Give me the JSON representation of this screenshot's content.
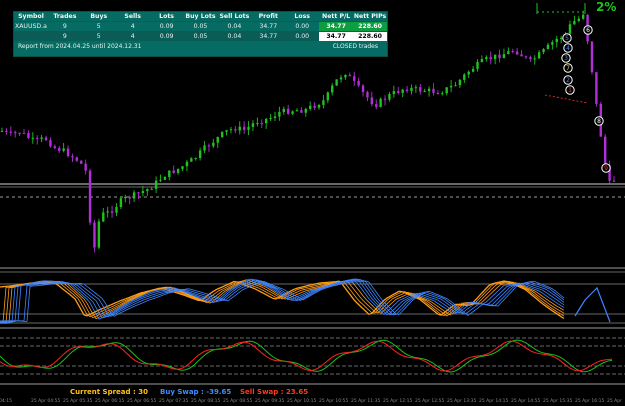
{
  "colors": {
    "bg": "#000000",
    "bull": "#1fc21f",
    "bear": "#b12fd8",
    "panel_bg": "#066b63",
    "swap_buy": "#3d8eff",
    "swap_sell": "#ff3b1f",
    "spread": "#ffc21a",
    "osc_orange": "#ff9c16",
    "osc_blue": "#3f86ff",
    "sig_green": "#18c218",
    "sig_red": "#ff2020"
  },
  "percent_badge": "2%",
  "trades_table": {
    "headers": [
      "Symbol",
      "Trades",
      "Buys",
      "Sells",
      "Lots",
      "Buy Lots",
      "Sell Lots",
      "Profit",
      "Loss",
      "Nett P/L",
      "Nett PIPs"
    ],
    "rows": [
      [
        "XAUUSD.a",
        "9",
        "5",
        "4",
        "0.09",
        "0.05",
        "0.04",
        "34.77",
        "0.00",
        "34.77",
        "228.60"
      ],
      [
        "",
        "9",
        "5",
        "4",
        "0.09",
        "0.05",
        "0.04",
        "34.77",
        "0.00",
        "34.77",
        "228.60"
      ]
    ]
  },
  "report": {
    "left": "Report from 2024.04.25 until 2024.12.31",
    "right": "CLOSED trades"
  },
  "status_bar": {
    "spread": "Current Spread : 30",
    "buy_swap": "Buy Swap : -39.65",
    "sell_swap": "Sell Swap : 23.65"
  },
  "trade_markers": [
    "4",
    "5",
    "6",
    "3",
    "7",
    "2",
    "1",
    "8",
    "9"
  ],
  "time_axis": [
    "04:15",
    "25 Apr 04:55",
    "25 Apr 05:35",
    "25 Apr 06:15",
    "25 Apr 06:55",
    "25 Apr 07:35",
    "25 Apr 08:15",
    "25 Apr 08:55",
    "25 Apr 09:35",
    "25 Apr 10:15",
    "25 Apr 10:55",
    "25 Apr 11:35",
    "25 Apr 12:15",
    "25 Apr 12:55",
    "25 Apr 13:35",
    "25 Apr 14:15",
    "25 Apr 14:55",
    "25 Apr 15:35",
    "25 Apr 16:15",
    "25 Apr"
  ]
}
